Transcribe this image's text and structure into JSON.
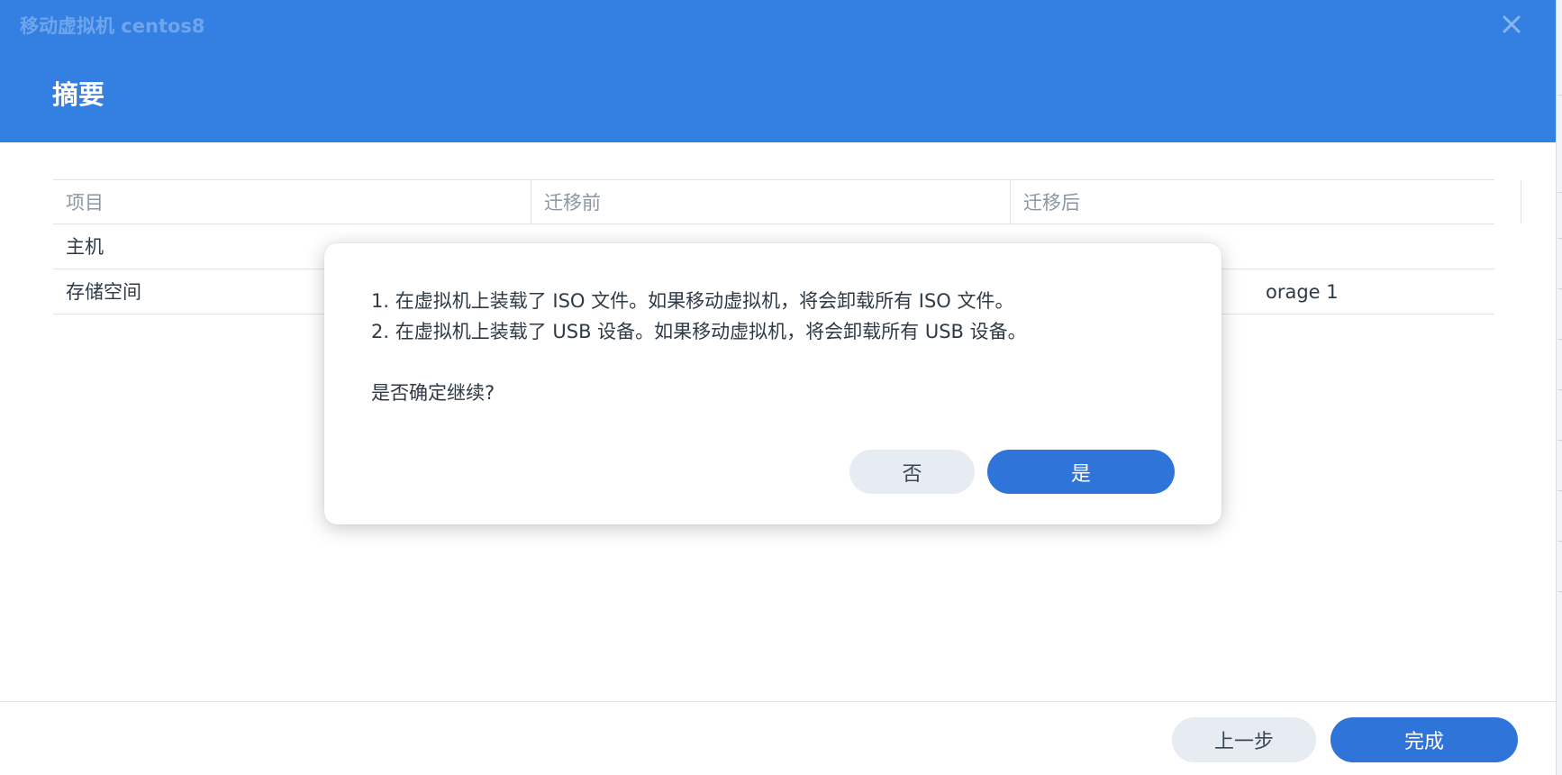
{
  "window": {
    "title": "移动虚拟机 centos8",
    "close_icon": "close-icon"
  },
  "step": {
    "title": "摘要"
  },
  "table": {
    "headers": [
      "项目",
      "迁移前",
      "迁移后",
      ""
    ],
    "rows": [
      [
        "主机",
        "",
        ""
      ],
      [
        "存储空间",
        "",
        "orage 1"
      ]
    ]
  },
  "dialog": {
    "line1": "1. 在虚拟机上装载了 ISO 文件。如果移动虚拟机，将会卸载所有 ISO 文件。",
    "line2": "2. 在虚拟机上装载了 USB 设备。如果移动虚拟机，将会卸载所有 USB 设备。",
    "question": "是否确定继续?",
    "no_label": "否",
    "yes_label": "是"
  },
  "footer": {
    "prev_label": "上一步",
    "finish_label": "完成"
  },
  "colors": {
    "header_bg": "#337fe2",
    "primary_button": "#2f74d8",
    "secondary_button": "#e6ecf2"
  }
}
